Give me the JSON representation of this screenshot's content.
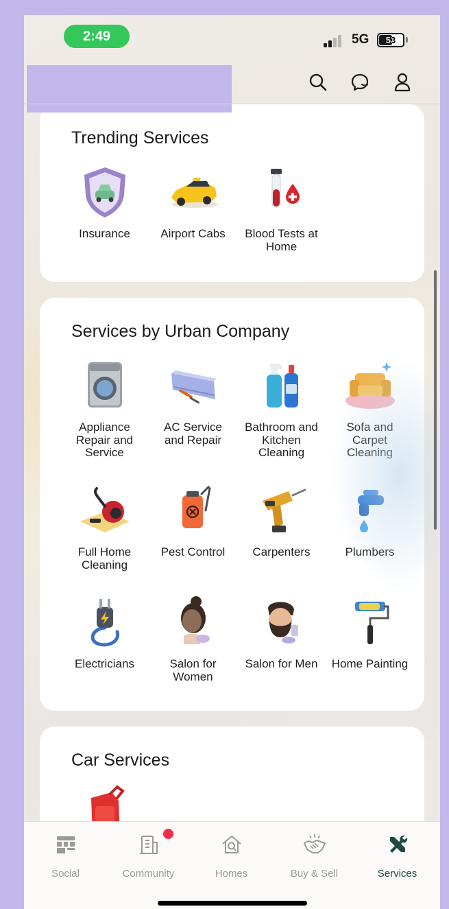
{
  "status": {
    "time": "2:49",
    "network": "5G",
    "battery": "53",
    "battery_level": 0.53
  },
  "header": {
    "icons": [
      "search-icon",
      "chat-icon",
      "profile-icon"
    ]
  },
  "trending": {
    "title": "Trending Services",
    "items": [
      {
        "label": "Insurance",
        "icon": "insurance-shield-icon"
      },
      {
        "label": "Airport Cabs",
        "icon": "taxi-icon"
      },
      {
        "label": "Blood Tests at\nHome",
        "icon": "blood-test-icon"
      }
    ]
  },
  "urban": {
    "title": "Services by Urban Company",
    "items": [
      {
        "label": "Appliance\nRepair and\nService",
        "icon": "washing-machine-icon"
      },
      {
        "label": "AC Service\nand Repair",
        "icon": "air-conditioner-icon"
      },
      {
        "label": "Bathroom and\nKitchen\nCleaning",
        "icon": "cleaning-bottles-icon"
      },
      {
        "label": "Sofa and\nCarpet\nCleaning",
        "icon": "sofa-icon"
      },
      {
        "label": "Full Home\nCleaning",
        "icon": "vacuum-cleaner-icon"
      },
      {
        "label": "Pest Control",
        "icon": "pest-sprayer-icon"
      },
      {
        "label": "Carpenters",
        "icon": "power-drill-icon"
      },
      {
        "label": "Plumbers",
        "icon": "water-tap-icon"
      },
      {
        "label": "Electricians",
        "icon": "electric-plug-icon"
      },
      {
        "label": "Salon for\nWomen",
        "icon": "woman-facial-icon"
      },
      {
        "label": "Salon for Men",
        "icon": "bearded-man-icon"
      },
      {
        "label": "Home Painting",
        "icon": "paint-roller-icon"
      }
    ]
  },
  "car": {
    "title": "Car Services",
    "items": [
      {
        "icon": "fuel-can-icon"
      }
    ]
  },
  "tabs": [
    {
      "label": "Social",
      "icon": "social-grid-icon",
      "active": false
    },
    {
      "label": "Community",
      "icon": "building-icon",
      "active": false,
      "badge": true
    },
    {
      "label": "Homes",
      "icon": "home-search-icon",
      "active": false
    },
    {
      "label": "Buy & Sell",
      "icon": "handshake-icon",
      "active": false
    },
    {
      "label": "Services",
      "icon": "tools-icon",
      "active": true
    }
  ],
  "colors": {
    "background": "#c1b7ea",
    "accent_active": "#1f4a44",
    "badge": "#ef2d45",
    "time_pill": "#34c759"
  }
}
